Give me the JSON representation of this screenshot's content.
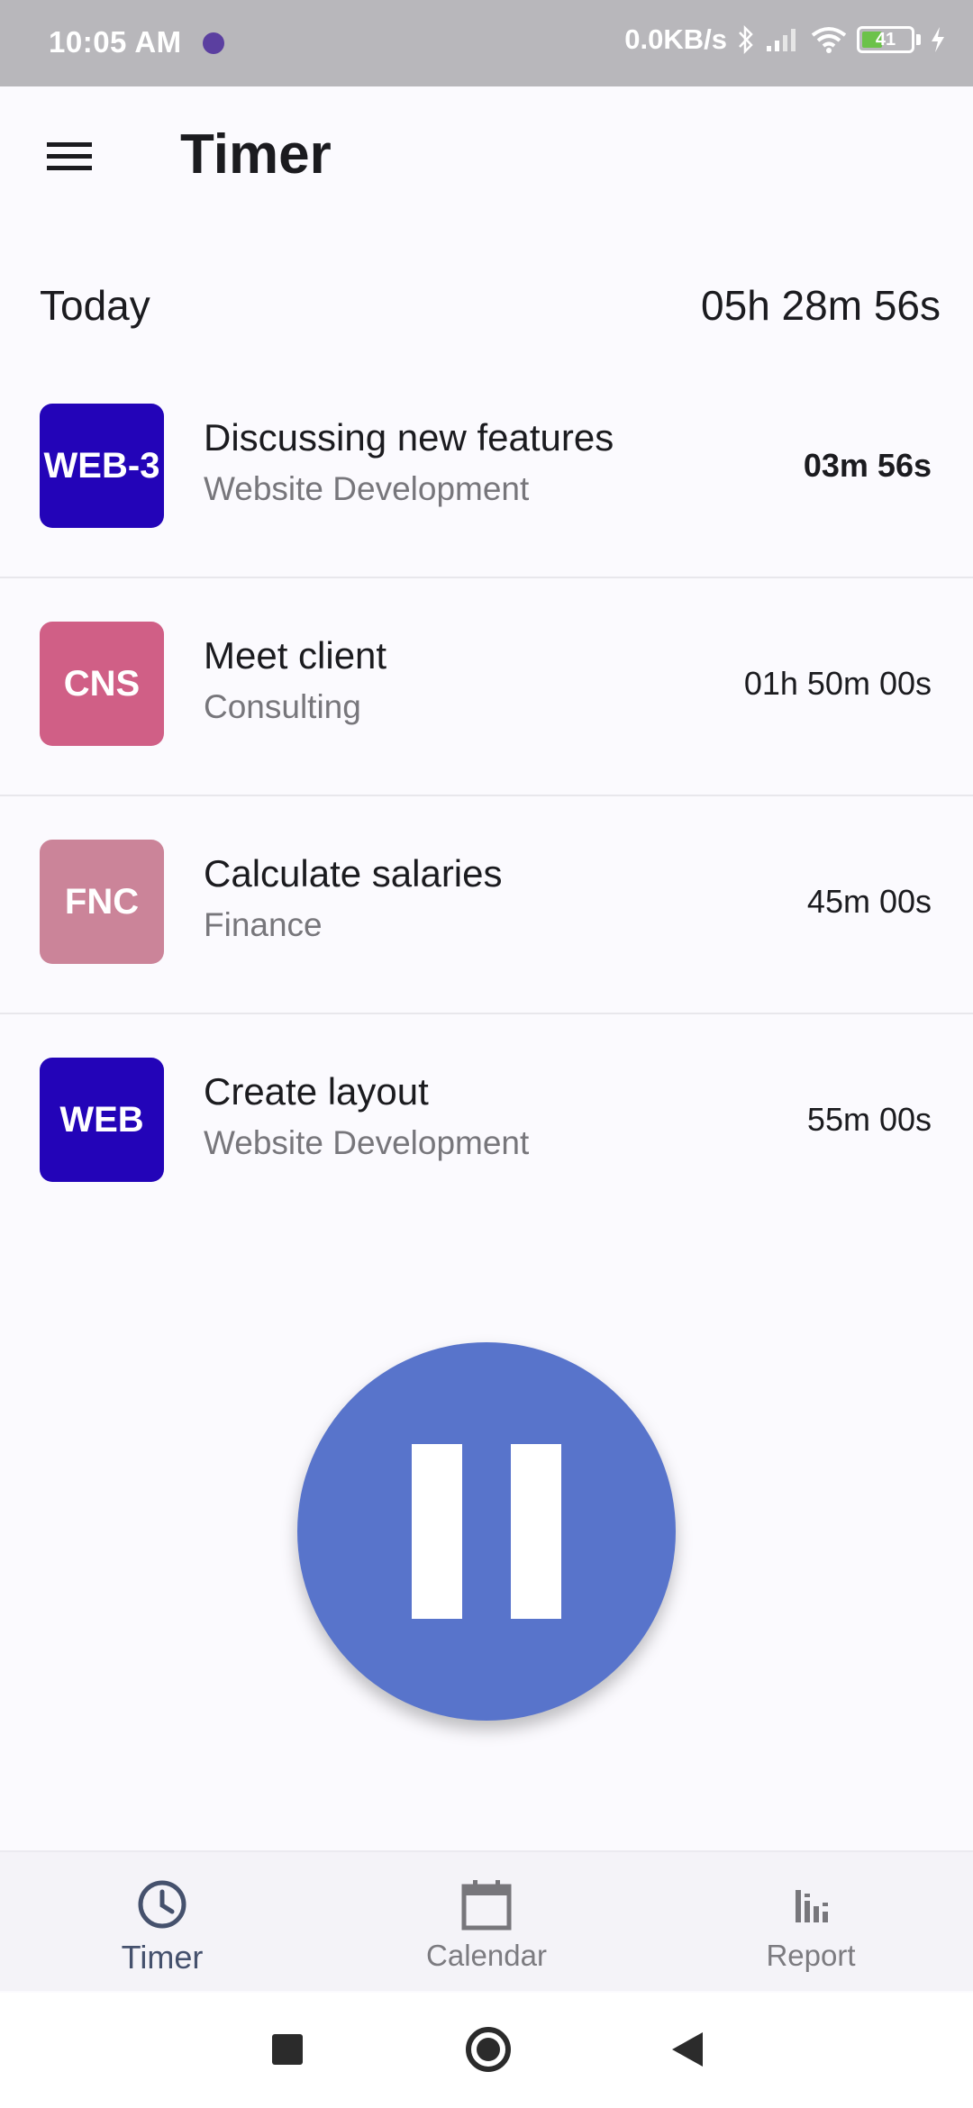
{
  "status_bar": {
    "time": "10:05 AM",
    "network_speed": "0.0KB/s",
    "battery_level": "41",
    "icons": [
      "app-notification-icon",
      "bluetooth-icon",
      "signal-icon",
      "wifi-icon",
      "battery-icon",
      "charging-icon"
    ]
  },
  "app_bar": {
    "title": "Timer",
    "menu_icon": "hamburger-menu-icon"
  },
  "summary": {
    "label": "Today",
    "total": "05h 28m 56s"
  },
  "entries": [
    {
      "badge": "WEB-3",
      "badge_color": "#2304b8",
      "title": "Discussing new features",
      "project": "Website Development",
      "duration": "03m 56s",
      "active": true
    },
    {
      "badge": "CNS",
      "badge_color": "#d05f86",
      "title": "Meet client",
      "project": "Consulting",
      "duration": "01h 50m 00s",
      "active": false
    },
    {
      "badge": "FNC",
      "badge_color": "#cb8499",
      "title": "Calculate salaries",
      "project": "Finance",
      "duration": "45m 00s",
      "active": false
    },
    {
      "badge": "WEB",
      "badge_color": "#2304b8",
      "title": "Create layout",
      "project": "Website Development",
      "duration": "55m 00s",
      "active": false
    }
  ],
  "fab": {
    "icon": "pause-icon",
    "color": "#5874cb"
  },
  "bottom_nav": {
    "items": [
      {
        "label": "Timer",
        "icon": "clock-icon",
        "active": true
      },
      {
        "label": "Calendar",
        "icon": "calendar-icon",
        "active": false
      },
      {
        "label": "Report",
        "icon": "bar-chart-icon",
        "active": false
      }
    ]
  },
  "system_nav": {
    "buttons": [
      "recent-apps-icon",
      "home-icon",
      "back-icon"
    ]
  }
}
